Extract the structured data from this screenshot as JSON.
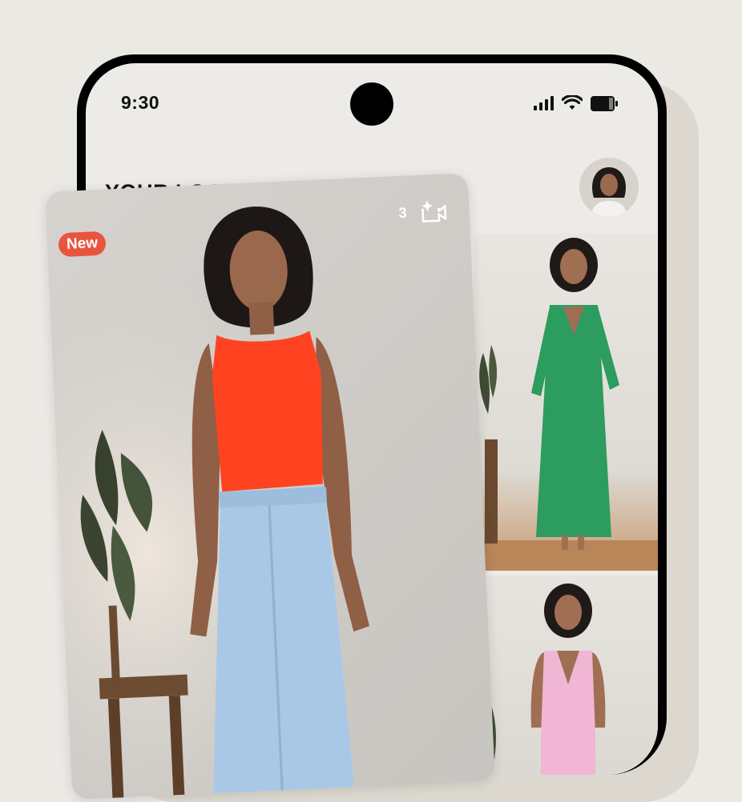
{
  "status_bar": {
    "time": "9:30"
  },
  "header": {
    "title": "YOUR LOOKS"
  },
  "featured_card": {
    "badge": "New",
    "count": "3",
    "icon": "video-sparkle-icon"
  },
  "colors": {
    "accent": "#e9543f",
    "background": "#ebe9e4",
    "top": "#ff4321",
    "skirt": "#a9c8e6",
    "dress": "#2d9c5f",
    "vest": "#f0b6d4"
  }
}
